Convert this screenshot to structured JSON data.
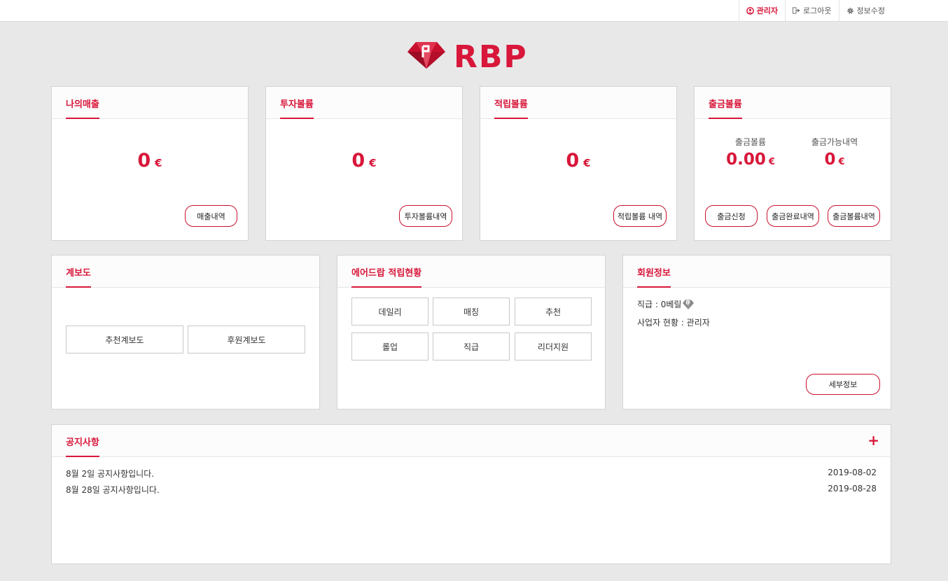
{
  "topnav": {
    "admin": "관리자",
    "logout": "로그아웃",
    "edit_info": "정보수정"
  },
  "logo": {
    "text": "RBP"
  },
  "cards": {
    "sales": {
      "title": "나의매출",
      "value": "0",
      "currency": "€",
      "button": "매출내역"
    },
    "invest": {
      "title": "투자볼륨",
      "value": "0",
      "currency": "€",
      "button": "투자볼륨내역"
    },
    "accum": {
      "title": "적립볼륨",
      "value": "0",
      "currency": "€",
      "button": "적립볼륨 내역"
    },
    "withdraw": {
      "title": "출금볼륨",
      "col1_label": "출금볼륨",
      "col1_value": "0.00",
      "col1_currency": "€",
      "col2_label": "출금가능내역",
      "col2_value": "0",
      "col2_currency": "€",
      "buttons": [
        "출금신청",
        "출금완료내역",
        "출금볼륨내역"
      ]
    }
  },
  "tree": {
    "title": "계보도",
    "buttons": [
      "추천계보도",
      "후원계보도"
    ]
  },
  "airdrop": {
    "title": "에어드랍 적립현황",
    "buttons": [
      "데일리",
      "매칭",
      "추천",
      "롤업",
      "직급",
      "리더지원"
    ]
  },
  "member": {
    "title": "회원정보",
    "rank_label": "직급 : 0베릴",
    "rank_badge": "0",
    "business_label": "사업자 현황 : 관리자",
    "detail_button": "세부정보"
  },
  "notice": {
    "title": "공지사항",
    "plus": "+",
    "items": [
      {
        "title": "8월 2일 공지사항입니다.",
        "date": "2019-08-02"
      },
      {
        "title": "8월 28일 공지사항입니다.",
        "date": "2019-08-28"
      }
    ]
  },
  "colors": {
    "accent": "#d8173a",
    "background": "#e8e8e8",
    "panel": "#ffffff"
  },
  "icons": {
    "admin": "user-circle-icon",
    "logout": "sign-out-icon",
    "edit_info": "gear-icon",
    "logo": "ruby-gem-icon"
  }
}
